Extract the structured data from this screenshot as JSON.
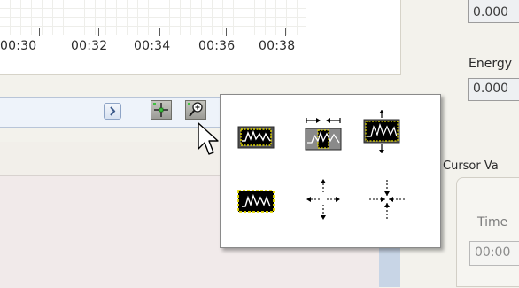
{
  "time_axis": {
    "tick_labels": [
      "00:30",
      "00:32",
      "00:34",
      "00:36",
      "00:38"
    ]
  },
  "right_panel": {
    "energy_top_value": "0.000",
    "energy_label": "Energy",
    "energy_value": "0.000",
    "cursor_values_label": "Cursor Va",
    "time_label": "Time",
    "time_value": "00:00"
  },
  "zoom_palette": {
    "tools": [
      {
        "name": "zoom-rectangle",
        "icon": "zoom-rectangle-icon"
      },
      {
        "name": "zoom-x",
        "icon": "zoom-x-icon"
      },
      {
        "name": "zoom-y",
        "icon": "zoom-y-icon"
      },
      {
        "name": "zoom-fit",
        "icon": "zoom-fit-icon"
      },
      {
        "name": "zoom-in-point",
        "icon": "zoom-in-point-icon"
      },
      {
        "name": "zoom-out-point",
        "icon": "zoom-out-point-icon"
      }
    ]
  },
  "colors": {
    "plot_background": "#000000",
    "plot_trace": "#ffffff",
    "plot_border": "#e6dc00",
    "panel_background": "#f3f2ec"
  }
}
